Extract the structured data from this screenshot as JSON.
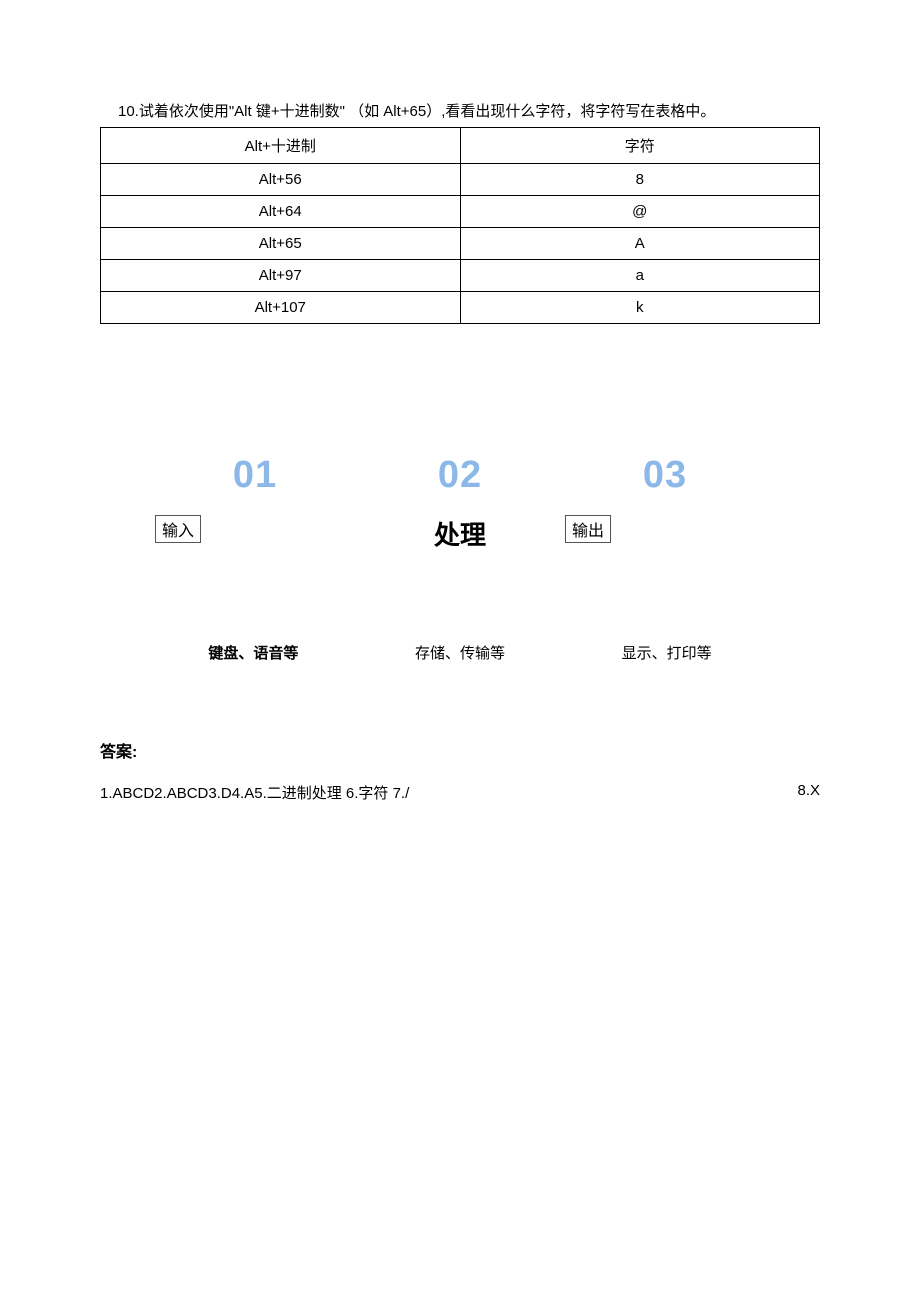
{
  "question": "10.试着依次使用\"Alt 键+十进制数\" （如 Alt+65）,看看出现什么字符，将字符写在表格中。",
  "table": {
    "headers": [
      "Alt+十进制",
      "字符"
    ],
    "rows": [
      [
        "Alt+56",
        "8"
      ],
      [
        "Alt+64",
        "@"
      ],
      [
        "Alt+65",
        "A"
      ],
      [
        "Alt+97",
        "a"
      ],
      [
        "Alt+107",
        "k"
      ]
    ]
  },
  "steps": [
    {
      "num": "01",
      "label": "输入",
      "style": "box"
    },
    {
      "num": "02",
      "label": "处理",
      "style": "big"
    },
    {
      "num": "03",
      "label": "输出",
      "style": "box"
    }
  ],
  "examples": [
    {
      "text": "键盘、语音等",
      "class": "bold"
    },
    {
      "text": "存储、传输等",
      "class": "serif"
    },
    {
      "text": "显示、打印等",
      "class": "serif"
    }
  ],
  "answers_title": "答案:",
  "answers_left": "1.ABCD2.ABCD3.D4.A5.二进制处理 6.字符 7./",
  "answers_right": "8.X"
}
